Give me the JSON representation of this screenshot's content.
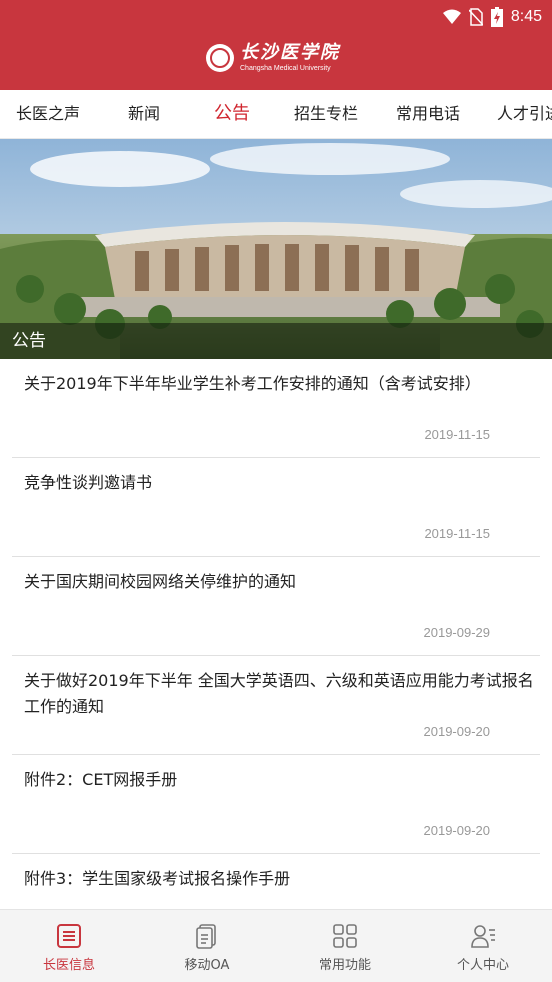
{
  "status": {
    "time": "8:45"
  },
  "header": {
    "logo_cn": "长沙医学院",
    "logo_en": "Changsha Medical University"
  },
  "tabs": [
    {
      "label": "长医之声"
    },
    {
      "label": "新闻"
    },
    {
      "label": "公告",
      "active": true
    },
    {
      "label": "招生专栏"
    },
    {
      "label": "常用电话"
    },
    {
      "label": "人才引进"
    }
  ],
  "banner": {
    "caption": "公告"
  },
  "notices": [
    {
      "title": "关于2019年下半年毕业学生补考工作安排的通知（含考试安排）",
      "date": "2019-11-15"
    },
    {
      "title": "竞争性谈判邀请书",
      "date": "2019-11-15"
    },
    {
      "title": "关于国庆期间校园网络关停维护的通知",
      "date": "2019-09-29"
    },
    {
      "title": "关于做好2019年下半年 全国大学英语四、六级和英语应用能力考试报名工作的通知",
      "date": "2019-09-20"
    },
    {
      "title": "附件2：CET网报手册",
      "date": "2019-09-20"
    },
    {
      "title": "附件3：学生国家级考试报名操作手册",
      "date": ""
    }
  ],
  "bottom_nav": [
    {
      "label": "长医信息",
      "icon": "news-list-icon",
      "active": true
    },
    {
      "label": "移动OA",
      "icon": "document-icon"
    },
    {
      "label": "常用功能",
      "icon": "grid-icon"
    },
    {
      "label": "个人中心",
      "icon": "user-icon"
    }
  ],
  "colors": {
    "brand_red": "#c8363e",
    "active_tab": "#d0262f"
  }
}
